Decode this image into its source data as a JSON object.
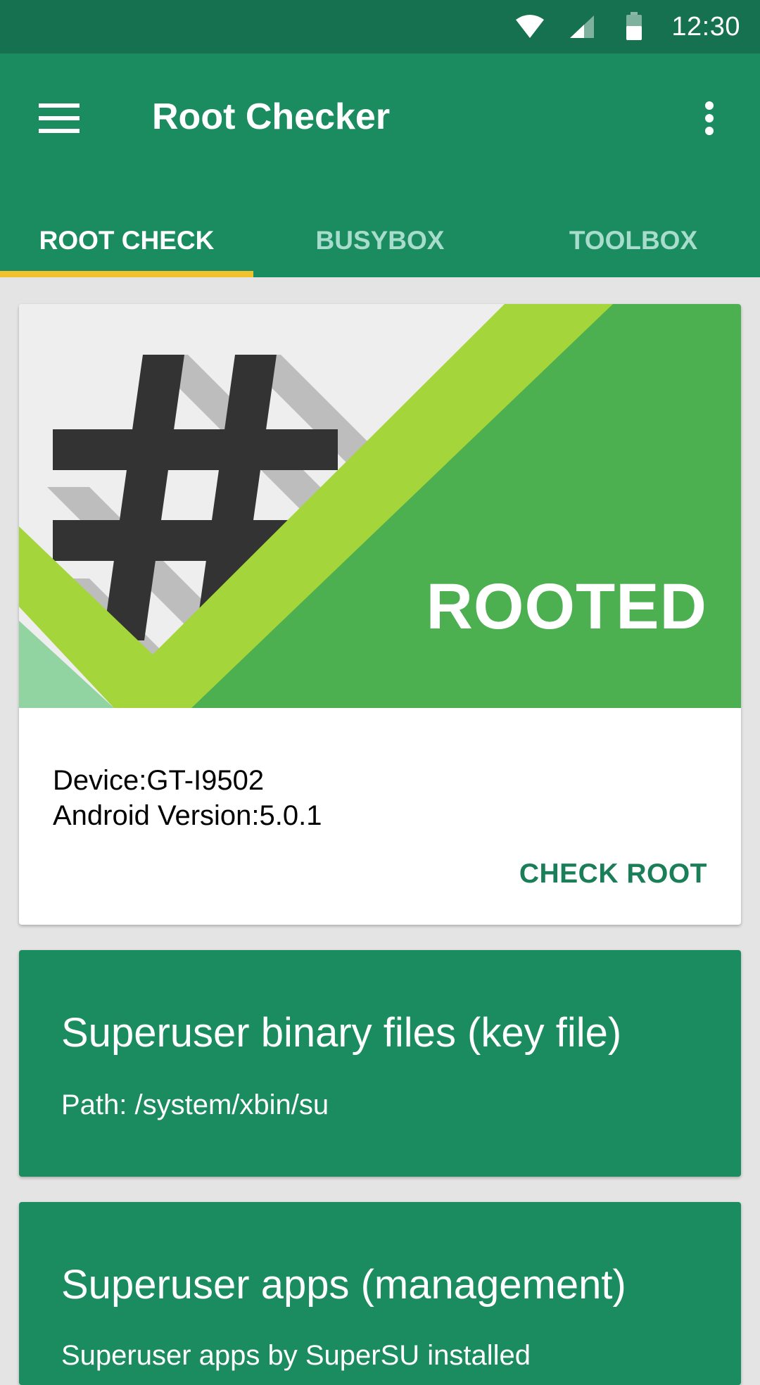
{
  "status_bar": {
    "time": "12:30",
    "icons": [
      "wifi-icon",
      "cell-signal-icon",
      "battery-icon"
    ]
  },
  "app_bar": {
    "title": "Root Checker",
    "menu_icon": "hamburger-menu-icon",
    "overflow_icon": "more-vert-icon"
  },
  "tabs": [
    {
      "label": "ROOT CHECK",
      "active": true
    },
    {
      "label": "BUSYBOX",
      "active": false
    },
    {
      "label": "TOOLBOX",
      "active": false
    }
  ],
  "root_card": {
    "status": "ROOTED",
    "device_line": "Device:GT-I9502",
    "android_line": "Android Version:5.0.1",
    "button_label": "CHECK ROOT"
  },
  "binary_card": {
    "title": "Superuser binary files (key file)",
    "path": "Path: /system/xbin/su"
  },
  "apps_card": {
    "title": "Superuser apps (management)",
    "subtitle": "Superuser apps by SuperSU installed"
  },
  "colors": {
    "primary": "#1b8c5f",
    "primary_dark": "#167150",
    "accent": "#f2c12e",
    "banner_green": "#4caf50",
    "check_lime": "#a4d53a",
    "background": "#e4e4e4"
  }
}
